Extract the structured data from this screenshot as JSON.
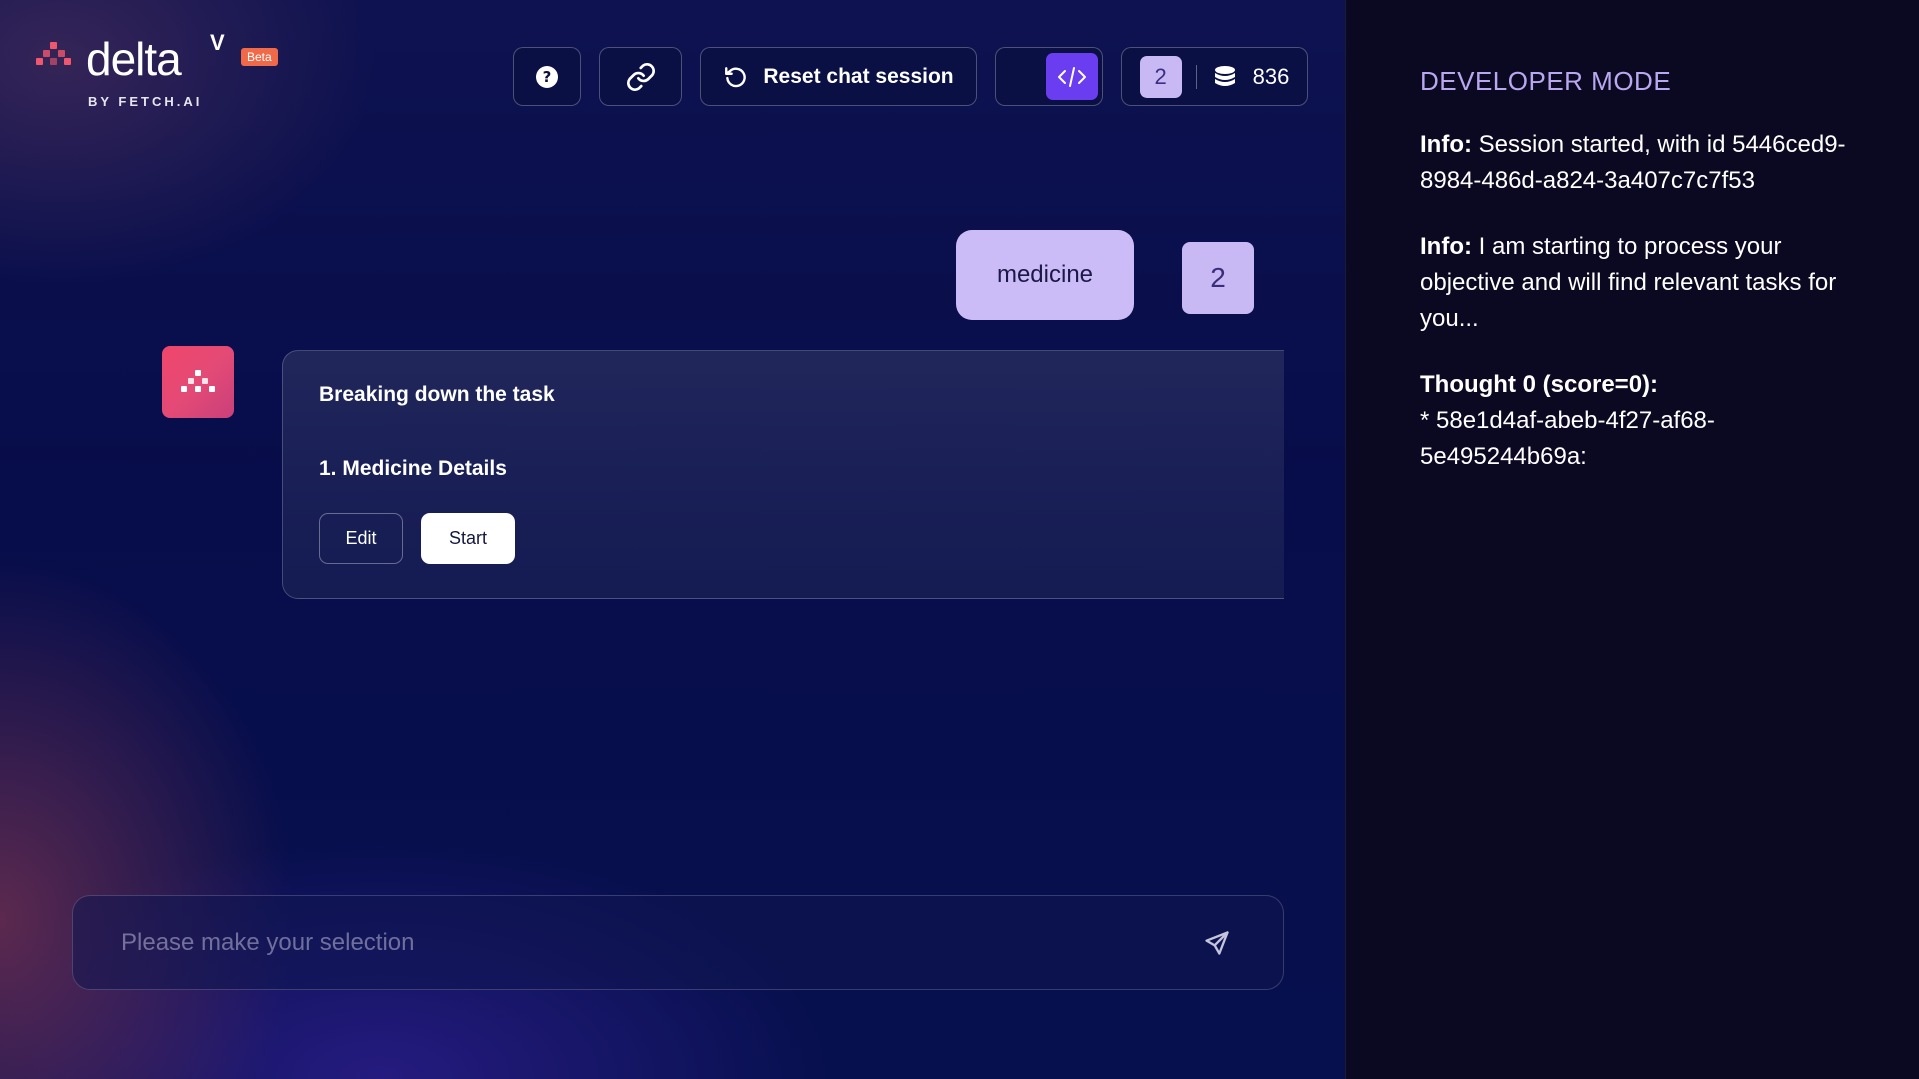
{
  "app": {
    "logo_text": "delta",
    "logo_sup": "V",
    "beta_badge": "Beta",
    "byline": "BY FETCH.AI"
  },
  "toolbar": {
    "reset_label": "Reset chat session",
    "agent_count": "2",
    "credits": "836"
  },
  "chat": {
    "user_message": "medicine",
    "user_avatar": "2",
    "bot_card": {
      "title": "Breaking down the task",
      "items": [
        "1. Medicine Details"
      ],
      "edit_label": "Edit",
      "start_label": "Start"
    }
  },
  "input": {
    "placeholder": "Please make your selection"
  },
  "dev_panel": {
    "title": "DEVELOPER MODE",
    "entries": [
      {
        "label": "Info:",
        "text": "Session started, with id 5446ced9-8984-486d-a824-3a407c7c7f53"
      },
      {
        "label": "Info:",
        "text": "I am starting to process your objective and will find relevant tasks for you..."
      },
      {
        "label": "Thought 0 (score=0):",
        "text": "* 58e1d4af-abeb-4f27-af68-5e495244b69a:"
      }
    ]
  },
  "colors": {
    "accent_purple": "#6a3df0",
    "user_bubble": "#cbbcf7",
    "brand_red": "#f0566e"
  }
}
